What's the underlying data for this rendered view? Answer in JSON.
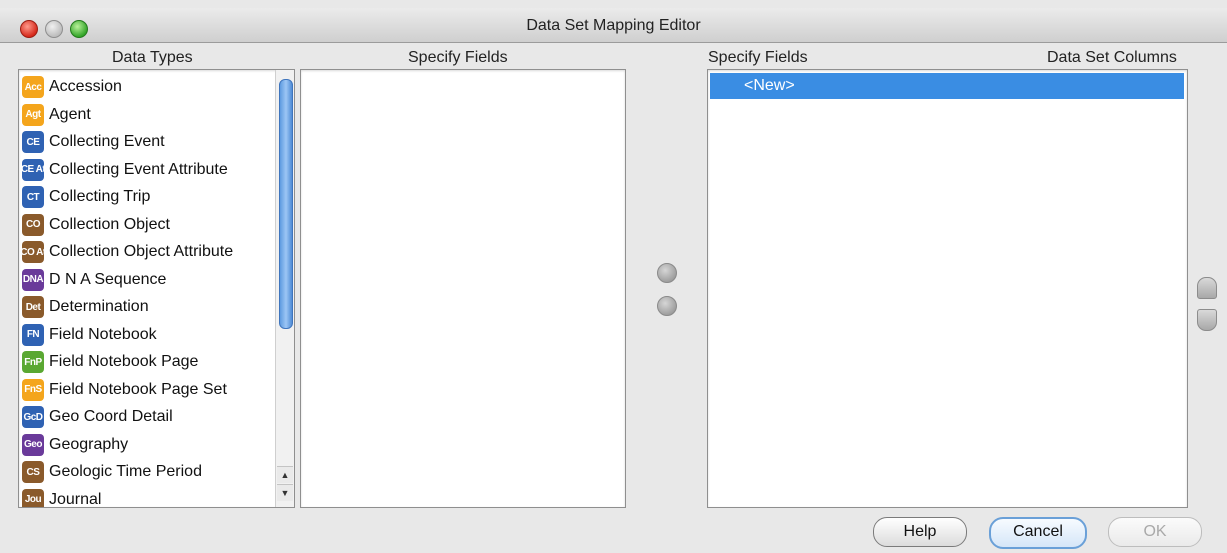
{
  "window": {
    "title": "Data Set Mapping Editor"
  },
  "headers": {
    "data_types": "Data Types",
    "specify_fields_left": "Specify Fields",
    "specify_fields_right": "Specify Fields",
    "data_set_columns": "Data Set Columns"
  },
  "data_types": [
    {
      "icon": "Acc",
      "label": "Accession",
      "color": "#f4a51c"
    },
    {
      "icon": "Agt",
      "label": "Agent",
      "color": "#f4a51c"
    },
    {
      "icon": "CE",
      "label": "Collecting Event",
      "color": "#2f62b3"
    },
    {
      "icon": "CE At",
      "label": "Collecting Event Attribute",
      "color": "#2f62b3"
    },
    {
      "icon": "CT",
      "label": "Collecting Trip",
      "color": "#2f62b3"
    },
    {
      "icon": "CO",
      "label": "Collection Object",
      "color": "#8a5a2b"
    },
    {
      "icon": "CO At",
      "label": "Collection Object Attribute",
      "color": "#8a5a2b"
    },
    {
      "icon": "DNA",
      "label": "D N A Sequence",
      "color": "#6a3a9a"
    },
    {
      "icon": "Det",
      "label": "Determination",
      "color": "#8a5a2b"
    },
    {
      "icon": "FN",
      "label": "Field Notebook",
      "color": "#2f62b3"
    },
    {
      "icon": "FnP",
      "label": "Field Notebook Page",
      "color": "#5aa832"
    },
    {
      "icon": "FnS",
      "label": "Field Notebook Page Set",
      "color": "#f4a51c"
    },
    {
      "icon": "GcD",
      "label": "Geo Coord Detail",
      "color": "#2f62b3"
    },
    {
      "icon": "Geo",
      "label": "Geography",
      "color": "#6a3a9a"
    },
    {
      "icon": "CS",
      "label": "Geologic Time Period",
      "color": "#8a5a2b"
    },
    {
      "icon": "Jou",
      "label": "Journal",
      "color": "#8a5a2b"
    }
  ],
  "columns": {
    "selected_item": "<New>"
  },
  "buttons": {
    "help": "Help",
    "cancel": "Cancel",
    "ok": "OK"
  }
}
